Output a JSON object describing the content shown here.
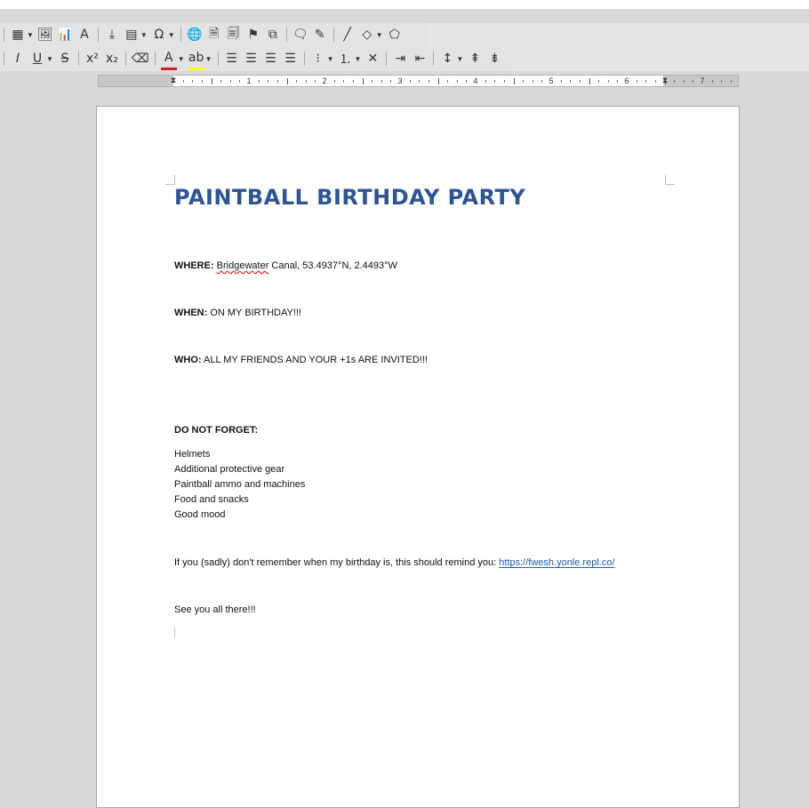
{
  "toolbar1": [
    {
      "name": "insert-table-icon",
      "glyph": "▦",
      "dropdown": true
    },
    {
      "name": "insert-image-icon",
      "glyph": "🖼",
      "dropdown": false
    },
    {
      "name": "insert-chart-icon",
      "glyph": "📊",
      "dropdown": false
    },
    {
      "name": "insert-textbox-icon",
      "glyph": "A",
      "dropdown": false
    },
    {
      "name": "page-break-icon",
      "glyph": "⤓",
      "dropdown": false
    },
    {
      "name": "insert-field-icon",
      "glyph": "▤",
      "dropdown": true
    },
    {
      "name": "special-character-icon",
      "glyph": "Ω",
      "dropdown": true
    },
    {
      "name": "hyperlink-icon",
      "glyph": "🌐",
      "dropdown": false
    },
    {
      "name": "footnote-icon",
      "glyph": "🗎",
      "dropdown": false
    },
    {
      "name": "endnote-icon",
      "glyph": "🗐",
      "dropdown": false
    },
    {
      "name": "bookmark-icon",
      "glyph": "⚑",
      "dropdown": false
    },
    {
      "name": "cross-reference-icon",
      "glyph": "⧉",
      "dropdown": false
    },
    {
      "name": "comment-icon",
      "glyph": "🗨",
      "dropdown": false
    },
    {
      "name": "track-changes-icon",
      "glyph": "✎",
      "dropdown": false
    },
    {
      "name": "line-icon",
      "glyph": "╱",
      "dropdown": false
    },
    {
      "name": "basic-shapes-icon",
      "glyph": "◇",
      "dropdown": true
    },
    {
      "name": "draw-functions-icon",
      "glyph": "⬠",
      "dropdown": false
    }
  ],
  "toolbar2": [
    {
      "name": "italic-icon",
      "glyph": "I",
      "dropdown": false
    },
    {
      "name": "underline-icon",
      "glyph": "U",
      "dropdown": true
    },
    {
      "name": "strikethrough-icon",
      "glyph": "S",
      "dropdown": false
    },
    {
      "name": "superscript-icon",
      "glyph": "x²",
      "dropdown": false
    },
    {
      "name": "subscript-icon",
      "glyph": "x₂",
      "dropdown": false
    },
    {
      "name": "clear-formatting-icon",
      "glyph": "⌫",
      "dropdown": false
    },
    {
      "name": "font-color-icon",
      "glyph": "A",
      "dropdown": true
    },
    {
      "name": "highlight-color-icon",
      "glyph": "ab",
      "dropdown": true
    },
    {
      "name": "align-left-icon",
      "glyph": "☰",
      "dropdown": false
    },
    {
      "name": "align-center-icon",
      "glyph": "☰",
      "dropdown": false
    },
    {
      "name": "align-right-icon",
      "glyph": "☰",
      "dropdown": false
    },
    {
      "name": "justify-icon",
      "glyph": "☰",
      "dropdown": false
    },
    {
      "name": "unordered-list-icon",
      "glyph": "⁝",
      "dropdown": true
    },
    {
      "name": "ordered-list-icon",
      "glyph": "⒈",
      "dropdown": true
    },
    {
      "name": "no-list-icon",
      "glyph": "✕",
      "dropdown": false
    },
    {
      "name": "increase-indent-icon",
      "glyph": "⇥",
      "dropdown": false
    },
    {
      "name": "decrease-indent-icon",
      "glyph": "⇤",
      "dropdown": false
    },
    {
      "name": "line-spacing-icon",
      "glyph": "↕",
      "dropdown": true
    },
    {
      "name": "paragraph-spacing-increase-icon",
      "glyph": "⇞",
      "dropdown": false
    },
    {
      "name": "paragraph-spacing-decrease-icon",
      "glyph": "⇟",
      "dropdown": false
    }
  ],
  "ruler": {
    "numbers": [
      "1",
      "2",
      "3",
      "4",
      "5",
      "6",
      "7"
    ]
  },
  "doc": {
    "title": "PAINTBALL BIRTHDAY PARTY",
    "where_label": "WHERE:",
    "where_word": "Bridgewater",
    "where_rest": " Canal, 53.4937°N, 2.4493°W",
    "when_label": "WHEN:",
    "when_value": " ON MY BIRTHDAY!!!",
    "who_label": "WHO:",
    "who_value": " ALL MY FRIENDS AND YOUR +1s ARE INVITED!!!",
    "forget_label": "DO NOT FORGET:",
    "items": [
      "Helmets",
      "Additional protective gear",
      "Paintball ammo and machines",
      "Food and snacks",
      "Good mood"
    ],
    "remind_text": "If you (sadly) don't remember when my birthday is, this should remind you: ",
    "remind_link": "https://fwesh.yonle.repl.co/",
    "closing": "See  you all there!!!"
  }
}
